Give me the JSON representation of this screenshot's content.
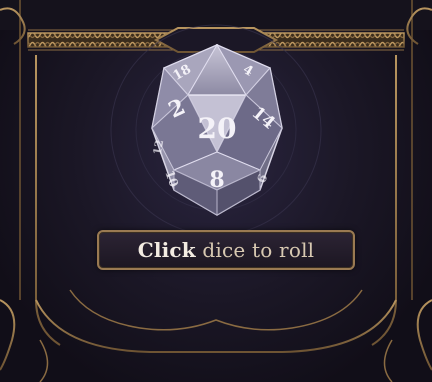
{
  "dice": {
    "type": "d20",
    "faces": {
      "top": "20",
      "upper_left": "18",
      "upper_right": "4",
      "left": "2",
      "right": "14",
      "bottom": "8",
      "side_left_a": "10",
      "side_left_b": "12",
      "side_right": "6"
    }
  },
  "roll_button": {
    "label_strong": "Click",
    "label_rest": " dice to roll"
  },
  "colors": {
    "frame_gold": "#9a7a52",
    "panel_dark": "#1b1726",
    "button_text": "#d8c9b2"
  }
}
